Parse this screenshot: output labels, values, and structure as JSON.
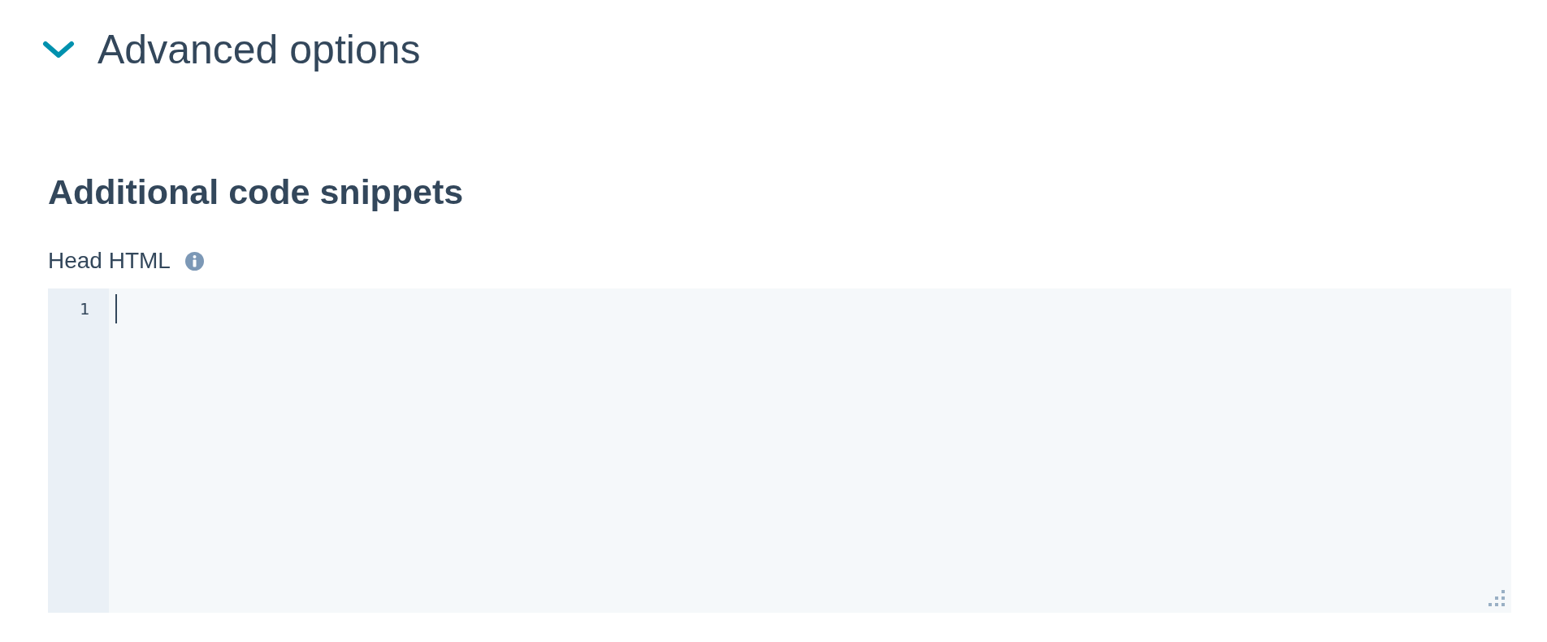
{
  "section": {
    "title": "Advanced options",
    "expanded": true
  },
  "subsection": {
    "title": "Additional code snippets"
  },
  "field": {
    "label": "Head HTML",
    "editor": {
      "line_numbers": [
        "1"
      ],
      "focused": true
    }
  }
}
